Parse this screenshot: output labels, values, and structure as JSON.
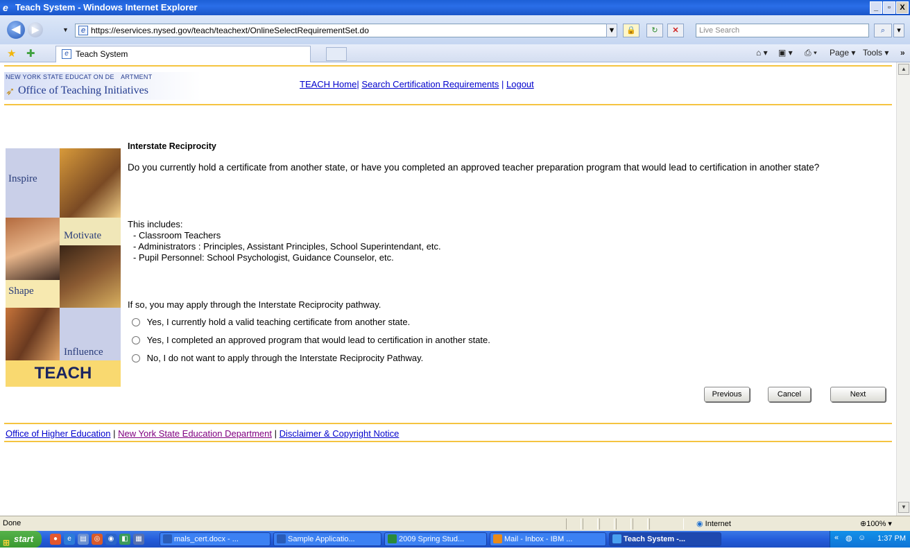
{
  "window": {
    "title": "Teach System - Windows Internet Explorer",
    "minimize": "_",
    "maximize": "▫",
    "close": "X"
  },
  "address_bar": {
    "url": "https://eservices.nysed.gov/teach/teachext/OnlineSelectRequirementSet.do",
    "search_placeholder": "Live Search"
  },
  "tabs": {
    "active_tab": "Teach System",
    "page_menu": "Page",
    "tools_menu": "Tools"
  },
  "header": {
    "dept_text": "NEW YORK STATE EDUCAT ON DE ARTMENT",
    "office_text": "Office of Teaching Initiatives",
    "nav": {
      "home": "TEACH Home",
      "search": "Search Certification Requirements",
      "logout": "Logout",
      "sep": "|"
    }
  },
  "collage": {
    "words": [
      "Inspire",
      "Motivate",
      "Shape",
      "Influence"
    ],
    "brand": "TEACH"
  },
  "main": {
    "heading": "Interstate Reciprocity",
    "question": "Do you currently hold a certificate from another state, or have you completed an approved teacher preparation program that would lead to certification in another state?",
    "includes_label": "This includes:",
    "includes": [
      "- Classroom Teachers",
      "- Administrators  : Principles, Assistant Principles, School Superintendant, etc.",
      "- Pupil Personnel: School Psychologist, Guidance Counselor, etc."
    ],
    "if_so": "If so, you may apply through the Interstate Reciprocity pathway.",
    "options": [
      "Yes, I currently hold a valid teaching certificate from another state.",
      "Yes, I completed an approved program that would lead to certification in another state.",
      "No, I do not want to apply through the Interstate Reciprocity Pathway."
    ]
  },
  "buttons": {
    "previous": "Previous",
    "cancel": "Cancel",
    "next": "Next"
  },
  "footer": {
    "link1": "Office of Higher Education",
    "link2": "New York State Education Department",
    "link3": "Disclaimer & Copyright Notice",
    "sep": "|"
  },
  "status_bar": {
    "status": "Done",
    "zone": "Internet",
    "zoom": "100%"
  },
  "taskbar": {
    "start": "start",
    "tasks": [
      "mals_cert.docx - ...",
      "Sample Applicatio...",
      "2009 Spring Stud...",
      "Mail - Inbox - IBM ...",
      "Teach System -..."
    ],
    "clock": "1:37 PM"
  },
  "colors": {
    "link_blue": "#0000cc",
    "visited_purple": "#800080",
    "accent_gold": "#f5c440",
    "xp_blue": "#245ddb"
  }
}
